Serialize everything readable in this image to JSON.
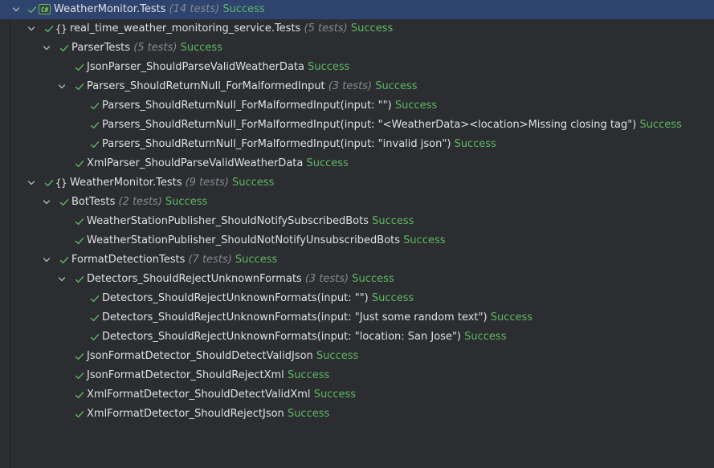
{
  "status_text": "Success",
  "colors": {
    "background": "#2b2d30",
    "selection": "#2e436e",
    "success": "#5fb865",
    "count": "#868a91",
    "text": "#dfe1e5"
  },
  "rows": [
    {
      "icon": "csharp-project-icon",
      "badge": "C#",
      "name": "WeatherMonitor.Tests",
      "count": "(14 tests)",
      "status": "Success",
      "level": 0,
      "expandable": true,
      "selected": true
    },
    {
      "icon": "namespace-icon",
      "badge": "{}",
      "name": "real_time_weather_monitoring_service.Tests",
      "count": "(5 tests)",
      "status": "Success",
      "level": 1,
      "expandable": true
    },
    {
      "icon": "",
      "name": "ParserTests",
      "count": "(5 tests)",
      "status": "Success",
      "level": 2,
      "expandable": true
    },
    {
      "icon": "",
      "name": "JsonParser_ShouldParseValidWeatherData",
      "count": "",
      "status": "Success",
      "level": 3,
      "expandable": false
    },
    {
      "icon": "",
      "name": "Parsers_ShouldReturnNull_ForMalformedInput",
      "count": "(3 tests)",
      "status": "Success",
      "level": 3,
      "expandable": true
    },
    {
      "icon": "",
      "name": "Parsers_ShouldReturnNull_ForMalformedInput(input: \"\")",
      "count": "",
      "status": "Success",
      "level": 4,
      "expandable": false
    },
    {
      "icon": "",
      "name": "Parsers_ShouldReturnNull_ForMalformedInput(input: \"<WeatherData><location>Missing closing tag\")",
      "count": "",
      "status": "Success",
      "level": 4,
      "expandable": false
    },
    {
      "icon": "",
      "name": "Parsers_ShouldReturnNull_ForMalformedInput(input: \"invalid json\")",
      "count": "",
      "status": "Success",
      "level": 4,
      "expandable": false
    },
    {
      "icon": "",
      "name": "XmlParser_ShouldParseValidWeatherData",
      "count": "",
      "status": "Success",
      "level": 3,
      "expandable": false
    },
    {
      "icon": "namespace-icon",
      "badge": "{}",
      "name": "WeatherMonitor.Tests",
      "count": "(9 tests)",
      "status": "Success",
      "level": 1,
      "expandable": true
    },
    {
      "icon": "",
      "name": "BotTests",
      "count": "(2 tests)",
      "status": "Success",
      "level": 2,
      "expandable": true
    },
    {
      "icon": "",
      "name": "WeatherStationPublisher_ShouldNotifySubscribedBots",
      "count": "",
      "status": "Success",
      "level": 3,
      "expandable": false
    },
    {
      "icon": "",
      "name": "WeatherStationPublisher_ShouldNotNotifyUnsubscribedBots",
      "count": "",
      "status": "Success",
      "level": 3,
      "expandable": false
    },
    {
      "icon": "",
      "name": "FormatDetectionTests",
      "count": "(7 tests)",
      "status": "Success",
      "level": 2,
      "expandable": true
    },
    {
      "icon": "",
      "name": "Detectors_ShouldRejectUnknownFormats",
      "count": "(3 tests)",
      "status": "Success",
      "level": 3,
      "expandable": true
    },
    {
      "icon": "",
      "name": "Detectors_ShouldRejectUnknownFormats(input: \"\")",
      "count": "",
      "status": "Success",
      "level": 4,
      "expandable": false
    },
    {
      "icon": "",
      "name": "Detectors_ShouldRejectUnknownFormats(input: \"Just some random text\")",
      "count": "",
      "status": "Success",
      "level": 4,
      "expandable": false
    },
    {
      "icon": "",
      "name": "Detectors_ShouldRejectUnknownFormats(input: \"location: San Jose\")",
      "count": "",
      "status": "Success",
      "level": 4,
      "expandable": false
    },
    {
      "icon": "",
      "name": "JsonFormatDetector_ShouldDetectValidJson",
      "count": "",
      "status": "Success",
      "level": 3,
      "expandable": false
    },
    {
      "icon": "",
      "name": "JsonFormatDetector_ShouldRejectXml",
      "count": "",
      "status": "Success",
      "level": 3,
      "expandable": false
    },
    {
      "icon": "",
      "name": "XmlFormatDetector_ShouldDetectValidXml",
      "count": "",
      "status": "Success",
      "level": 3,
      "expandable": false
    },
    {
      "icon": "",
      "name": "XmlFormatDetector_ShouldRejectJson",
      "count": "",
      "status": "Success",
      "level": 3,
      "expandable": false
    }
  ]
}
